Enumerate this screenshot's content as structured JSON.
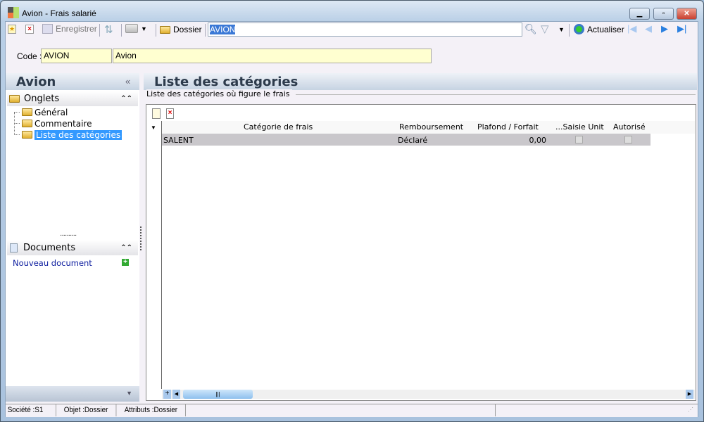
{
  "window": {
    "title": "Avion -  Frais salarié"
  },
  "toolbar": {
    "save": "Enregistrer",
    "dossier": "Dossier",
    "search_value": "AVION",
    "refresh": "Actualiser"
  },
  "code": {
    "label": "Code :",
    "value": "AVION",
    "name": "Avion"
  },
  "sidebar": {
    "title": "Avion",
    "tabs_group": "Onglets",
    "items": [
      {
        "label": "Général"
      },
      {
        "label": "Commentaire"
      },
      {
        "label": "Liste des catégories"
      }
    ],
    "docs_group": "Documents",
    "new_doc": "Nouveau document"
  },
  "main": {
    "title": "Liste des catégories",
    "group_label": "Liste des catégories où figure le frais",
    "columns": [
      "Catégorie de frais",
      "Remboursement",
      "Plafond / Forfait",
      "...Saisie Unit",
      "Autorisé"
    ],
    "rows": [
      {
        "categorie": "SALENT",
        "remboursement": "Déclaré",
        "plafond": "0,00",
        "saisie_unit": false,
        "autorise": false
      }
    ]
  },
  "status": {
    "societe": "Société :S1",
    "objet": "Objet :Dossier",
    "attributs": "Attributs :Dossier"
  }
}
